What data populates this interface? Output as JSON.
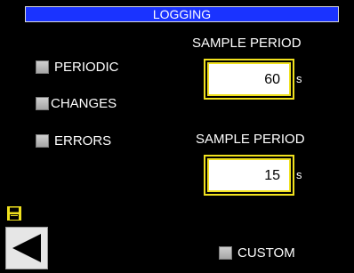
{
  "title": "LOGGING",
  "options": [
    {
      "label": "PERIODIC",
      "checked": false
    },
    {
      "label": "CHANGES",
      "checked": false
    },
    {
      "label": "ERRORS",
      "checked": false
    }
  ],
  "periodic_sample": {
    "label": "SAMPLE PERIOD",
    "value": "60",
    "unit": "s"
  },
  "changes_sample": {
    "label": "SAMPLE PERIOD",
    "value": "15",
    "unit": "s"
  },
  "custom": {
    "label": "CUSTOM",
    "checked": false
  },
  "icons": {
    "save": "floppy-disk-icon",
    "back": "left-arrow-icon"
  },
  "colors": {
    "title_bar": "#1a33ff",
    "field_border": "#f0e11e",
    "background": "#000000"
  }
}
